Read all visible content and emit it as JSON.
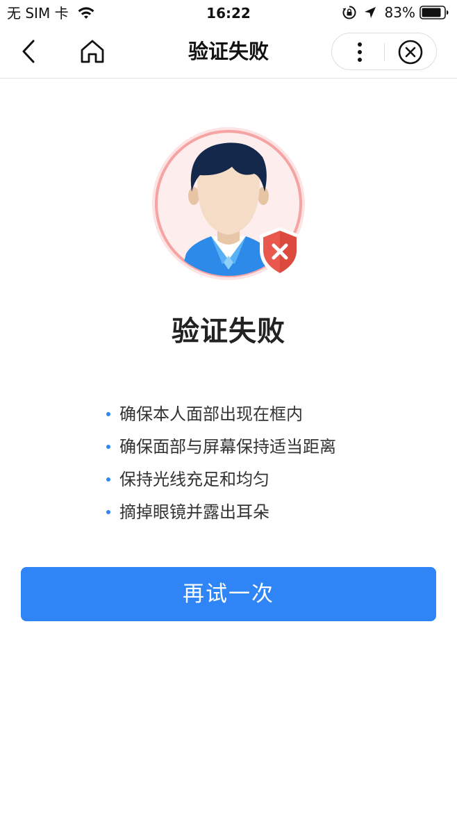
{
  "status_bar": {
    "carrier": "无 SIM 卡",
    "time": "16:22",
    "battery": "83%",
    "icons": [
      "wifi-icon",
      "orientation-lock-icon",
      "location-arrow-icon",
      "battery-icon"
    ]
  },
  "nav": {
    "title": "验证失败",
    "icons": [
      "back-arrow-icon",
      "home-icon",
      "more-vertical-icon",
      "close-circle-icon"
    ]
  },
  "result": {
    "illustration": "face-avatar-with-error-shield",
    "title": "验证失败",
    "accent_color": "#3085f6",
    "error_color": "#e9584c"
  },
  "tips": [
    "确保本人面部出现在框内",
    "确保面部与屏幕保持适当距离",
    "保持光线充足和均匀",
    "摘掉眼镜并露出耳朵"
  ],
  "actions": {
    "retry_label": "再试一次"
  }
}
